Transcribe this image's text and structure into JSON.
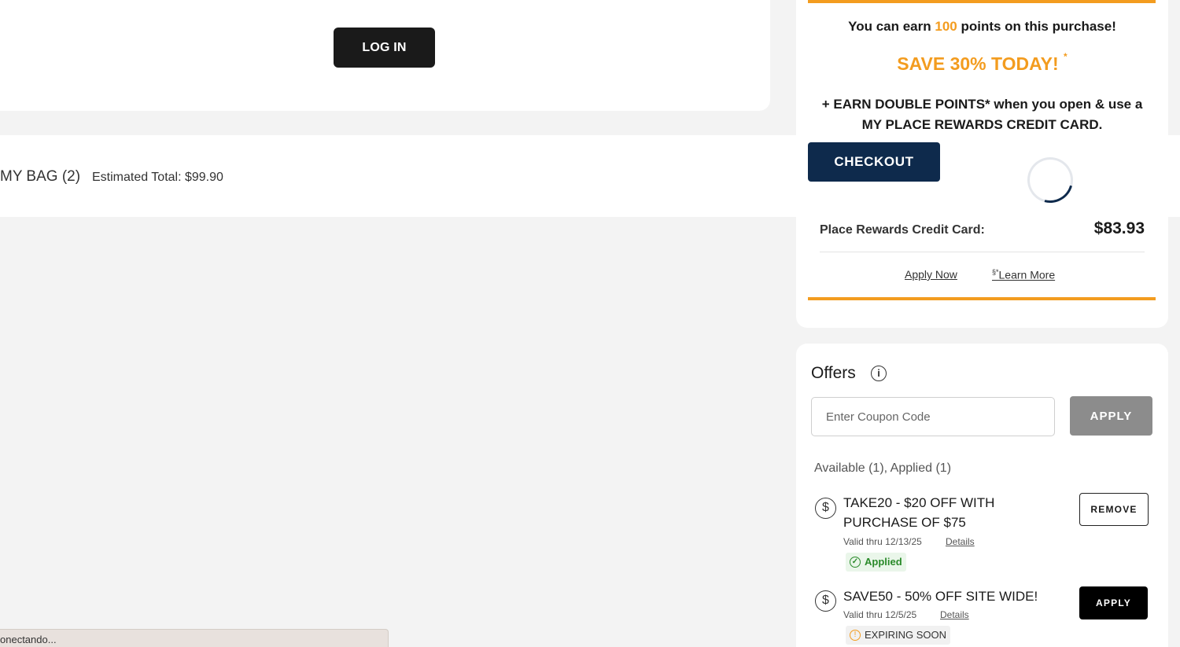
{
  "login": {
    "button_label": "LOG IN"
  },
  "rewards": {
    "earn_prefix": "You can earn ",
    "earn_points": "100",
    "earn_suffix": " points on this purchase!",
    "save_text": "SAVE 30% TODAY!",
    "save_sup": "*",
    "double_points_text": "+ EARN DOUBLE POINTS* when you open & use a MY PLACE REWARDS CREDIT CARD.",
    "credit_card_label": "Place Rewards Credit Card:",
    "credit_card_price": "$83.93",
    "apply_now": "Apply Now",
    "learn_more_sup": "§*",
    "learn_more": "Learn More",
    "accent_color": "#f39c1f"
  },
  "bag_bar": {
    "bag_label": "MY BAG (2)",
    "estimated_total": "Estimated Total: $99.90",
    "checkout_label": "CHECKOUT",
    "checkout_color": "#0e2a4c"
  },
  "offers": {
    "title": "Offers",
    "info_icon": "i",
    "coupon_placeholder": "Enter Coupon Code",
    "coupon_value": "",
    "apply_label": "APPLY",
    "counts": "Available (1),  Applied (1)",
    "items": [
      {
        "icon": "$",
        "title": "TAKE20 - $20 OFF WITH PURCHASE OF $75",
        "valid": "Valid thru 12/13/25",
        "details": "Details",
        "badge_icon": "✓",
        "badge": "Applied",
        "action": "REMOVE"
      },
      {
        "icon": "$",
        "title": "SAVE50 - 50% OFF SITE WIDE!",
        "valid": "Valid thru 12/5/25",
        "details": "Details",
        "badge_icon": "!",
        "badge": "EXPIRING SOON",
        "action": "APPLY"
      }
    ]
  },
  "status_bar": {
    "text": "onectando..."
  }
}
